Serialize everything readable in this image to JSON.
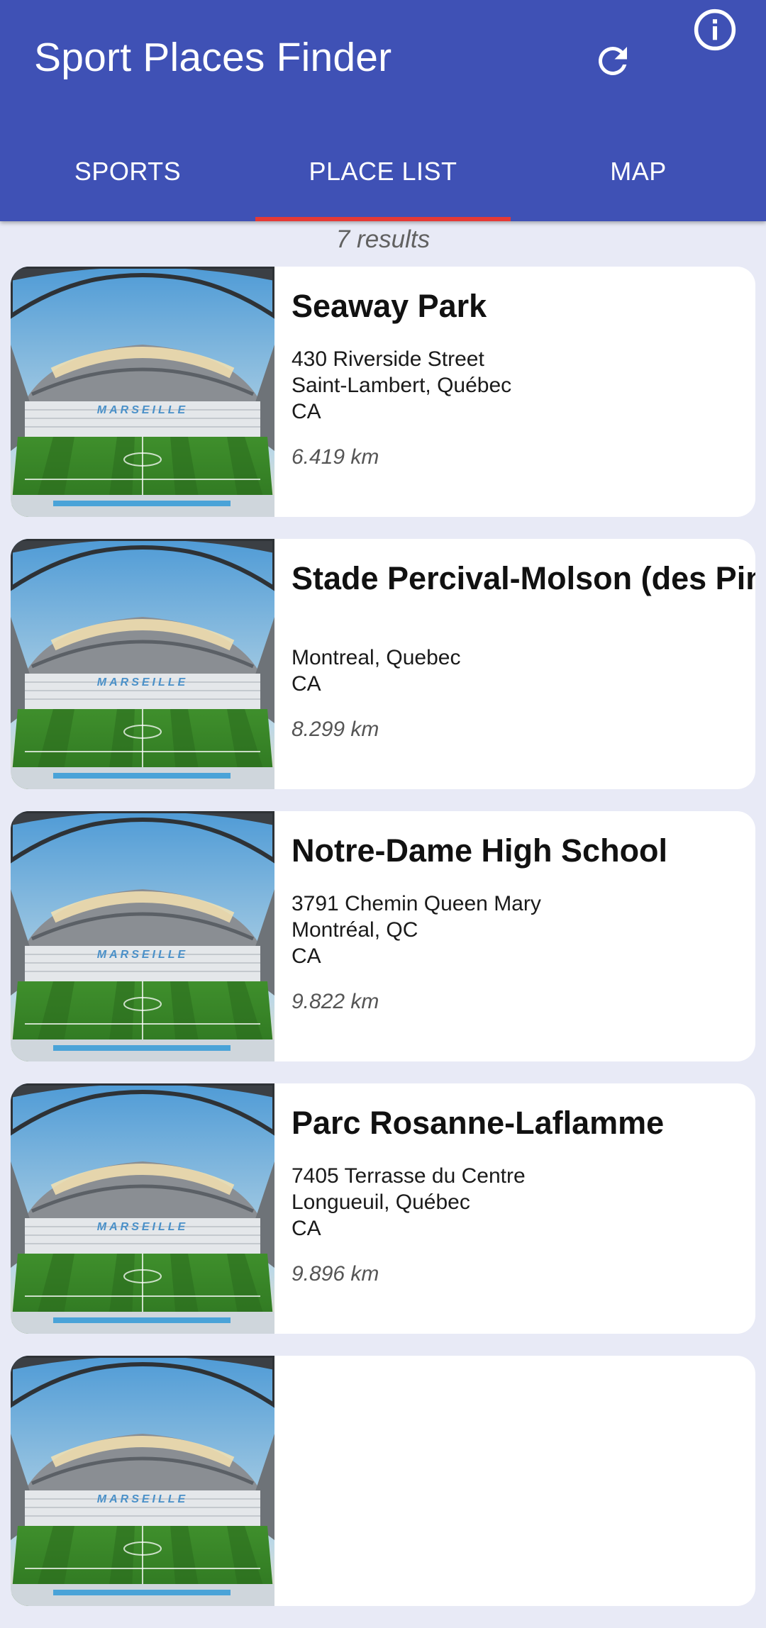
{
  "app": {
    "title": "Sport Places Finder"
  },
  "actions": [
    {
      "name": "refresh",
      "icon": "refresh-icon"
    },
    {
      "name": "info",
      "icon": "info-icon"
    }
  ],
  "tabs": [
    {
      "label": "SPORTS",
      "active": false
    },
    {
      "label": "PLACE LIST",
      "active": true
    },
    {
      "label": "MAP",
      "active": false
    }
  ],
  "results_label": "7 results",
  "colors": {
    "primary": "#3f51b5",
    "tab_indicator": "#e53935",
    "background": "#e8eaf6"
  },
  "places": [
    {
      "name": "Seaway Park",
      "address_lines": [
        "430 Riverside Street",
        "Saint-Lambert, Québec",
        "CA"
      ],
      "distance": "6.419 km",
      "image": "stadium-photo",
      "image_text": "MARSEILLE"
    },
    {
      "name": "Stade Percival-Molson (des Pins)",
      "address_lines": [
        "",
        "Montreal, Quebec",
        "CA"
      ],
      "distance": "8.299 km",
      "image": "stadium-photo",
      "image_text": "MARSEILLE"
    },
    {
      "name": "Notre-Dame High School",
      "address_lines": [
        "3791 Chemin Queen Mary",
        "Montréal, QC",
        "CA"
      ],
      "distance": "9.822 km",
      "image": "stadium-photo",
      "image_text": "MARSEILLE"
    },
    {
      "name": "Parc Rosanne-Laflamme",
      "address_lines": [
        "7405 Terrasse du Centre",
        "Longueuil, Québec",
        "CA"
      ],
      "distance": "9.896 km",
      "image": "stadium-photo",
      "image_text": "MARSEILLE"
    }
  ]
}
